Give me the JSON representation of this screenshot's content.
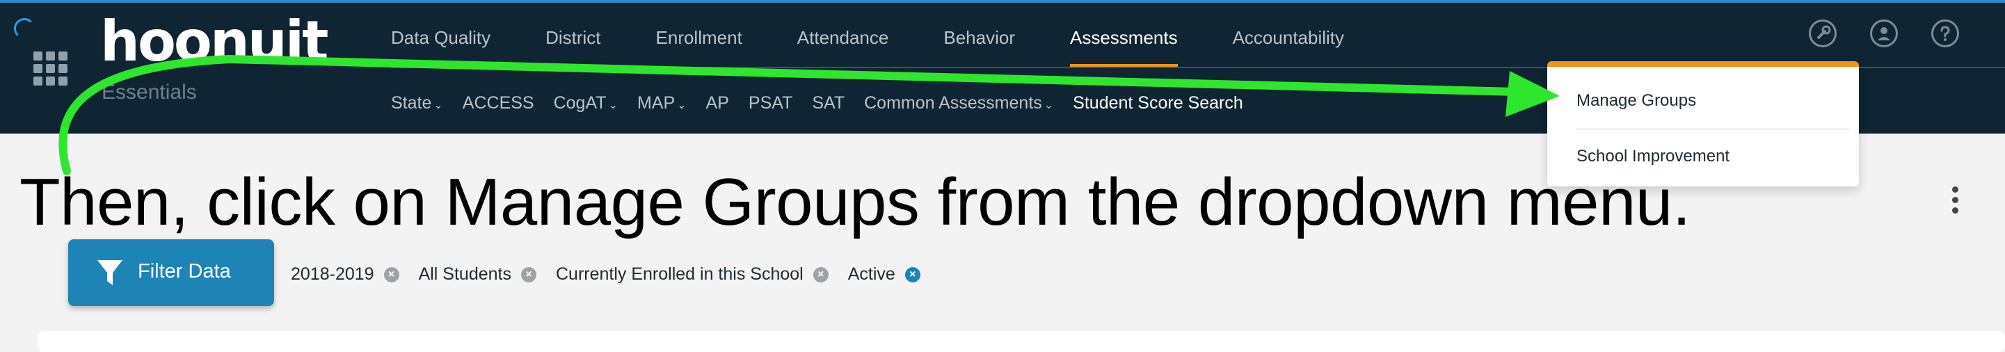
{
  "brand": {
    "logo": "hoonuit",
    "subtitle": "Essentials"
  },
  "primary_nav": {
    "items": [
      {
        "label": "Data Quality"
      },
      {
        "label": "District"
      },
      {
        "label": "Enrollment"
      },
      {
        "label": "Attendance"
      },
      {
        "label": "Behavior"
      },
      {
        "label": "Assessments",
        "active": true
      },
      {
        "label": "Accountability"
      }
    ]
  },
  "secondary_nav": {
    "items": [
      {
        "label": "State",
        "chevron": "⌄"
      },
      {
        "label": "ACCESS"
      },
      {
        "label": "CogAT",
        "chevron": "⌄"
      },
      {
        "label": "MAP",
        "chevron": "⌄"
      },
      {
        "label": "AP"
      },
      {
        "label": "PSAT"
      },
      {
        "label": "SAT"
      },
      {
        "label": "Common Assessments",
        "chevron": "⌄"
      },
      {
        "label": "Student Score Search",
        "active": true
      }
    ]
  },
  "header_icons": [
    "tools-icon",
    "user-icon",
    "help-icon"
  ],
  "dropdown": {
    "items": [
      {
        "label": "Manage Groups"
      },
      {
        "label": "School Improvement"
      }
    ]
  },
  "caption": "Then, click on Manage Groups from the dropdown menu.",
  "filter": {
    "button_label": "Filter Data",
    "chips": [
      {
        "label": "2018-2019",
        "remove": "×"
      },
      {
        "label": "All Students",
        "remove": "×"
      },
      {
        "label": "Currently Enrolled in this School",
        "remove": "×"
      },
      {
        "label": "Active",
        "remove": "×",
        "accent": true
      }
    ]
  },
  "colors": {
    "header_bg": "#0f2533",
    "accent_orange": "#f0941e",
    "button_blue": "#1d84b5",
    "annotation_green": "#2ee62e"
  }
}
